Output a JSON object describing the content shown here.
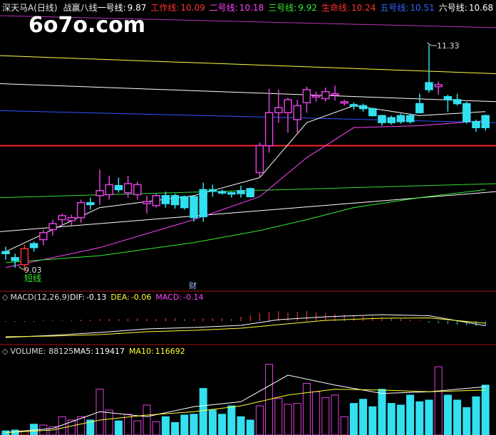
{
  "header": {
    "stock": "深天马A",
    "period": "(日线)",
    "indicator": "战赢八线",
    "lines": [
      {
        "label": "一号线:",
        "value": "9.87",
        "color": "#ffffff"
      },
      {
        "label": "工作线:",
        "value": "10.09",
        "color": "#ff3333"
      },
      {
        "label": "二号线:",
        "value": "10.18",
        "color": "#ff44ff"
      },
      {
        "label": "三号线:",
        "value": "9.92",
        "color": "#33ee33"
      },
      {
        "label": "生命线:",
        "value": "10.24",
        "color": "#ff3333"
      },
      {
        "label": "五号线:",
        "value": "10.51",
        "color": "#3366ff"
      },
      {
        "label": "六号线:",
        "value": "10.68",
        "color": "#ffffff"
      }
    ]
  },
  "watermark": "6o7o.com",
  "annotations": {
    "high": "11.33",
    "low": "9.03",
    "short_line": "短线",
    "finance_marker": "财"
  },
  "macd_panel": {
    "title": "MACD(12,26,9)",
    "items": [
      {
        "label": "DIF:",
        "value": "-0.13",
        "color": "#ffffff"
      },
      {
        "label": "DEA:",
        "value": "-0.06",
        "color": "#ffff33"
      },
      {
        "label": "MACD:",
        "value": "-0.14",
        "color": "#ff44ff"
      }
    ]
  },
  "volume_panel": {
    "title": "VOLUME:",
    "value": "88125",
    "items": [
      {
        "label": "MA5:",
        "value": "119417",
        "color": "#ffffff"
      },
      {
        "label": "MA10:",
        "value": "116692",
        "color": "#ffff33"
      }
    ]
  },
  "chart_data": {
    "type": "candlestick",
    "price_range": [
      8.9,
      11.62
    ],
    "candles": [
      {
        "o": 9.26,
        "h": 9.31,
        "l": 9.18,
        "c": 9.24,
        "color": "cyan"
      },
      {
        "o": 9.2,
        "h": 9.24,
        "l": 9.1,
        "c": 9.17,
        "color": "cyan"
      },
      {
        "o": 9.13,
        "h": 9.33,
        "l": 9.06,
        "c": 9.29,
        "color": "red"
      },
      {
        "o": 9.3,
        "h": 9.36,
        "l": 9.26,
        "c": 9.34,
        "color": "cyan"
      },
      {
        "o": 9.38,
        "h": 9.48,
        "l": 9.32,
        "c": 9.45,
        "color": "magenta"
      },
      {
        "o": 9.48,
        "h": 9.58,
        "l": 9.42,
        "c": 9.54,
        "color": "magenta"
      },
      {
        "o": 9.58,
        "h": 9.64,
        "l": 9.52,
        "c": 9.62,
        "color": "magenta"
      },
      {
        "o": 9.57,
        "h": 9.63,
        "l": 9.52,
        "c": 9.6,
        "color": "magenta"
      },
      {
        "o": 9.6,
        "h": 9.78,
        "l": 9.55,
        "c": 9.75,
        "color": "magenta"
      },
      {
        "o": 9.73,
        "h": 9.8,
        "l": 9.68,
        "c": 9.75,
        "color": "cyan"
      },
      {
        "o": 9.82,
        "h": 10.08,
        "l": 9.73,
        "c": 9.87,
        "color": "magenta"
      },
      {
        "o": 9.83,
        "h": 10.02,
        "l": 9.78,
        "c": 9.93,
        "color": "magenta"
      },
      {
        "o": 9.92,
        "h": 10.0,
        "l": 9.85,
        "c": 9.88,
        "color": "cyan"
      },
      {
        "o": 9.85,
        "h": 10.02,
        "l": 9.8,
        "c": 9.94,
        "color": "magenta"
      },
      {
        "o": 9.93,
        "h": 9.96,
        "l": 9.78,
        "c": 9.83,
        "color": "magenta"
      },
      {
        "o": 9.74,
        "h": 9.82,
        "l": 9.64,
        "c": 9.76,
        "color": "magenta"
      },
      {
        "o": 9.72,
        "h": 9.84,
        "l": 9.7,
        "c": 9.82,
        "color": "magenta"
      },
      {
        "o": 9.82,
        "h": 9.86,
        "l": 9.7,
        "c": 9.74,
        "color": "cyan"
      },
      {
        "o": 9.73,
        "h": 9.84,
        "l": 9.69,
        "c": 9.82,
        "color": "cyan"
      },
      {
        "o": 9.81,
        "h": 9.82,
        "l": 9.68,
        "c": 9.7,
        "color": "cyan"
      },
      {
        "o": 9.81,
        "h": 9.82,
        "l": 9.56,
        "c": 9.6,
        "color": "cyan"
      },
      {
        "o": 9.61,
        "h": 9.95,
        "l": 9.56,
        "c": 9.88,
        "color": "cyan"
      },
      {
        "o": 9.88,
        "h": 9.93,
        "l": 9.81,
        "c": 9.88,
        "color": "cyan"
      },
      {
        "o": 9.86,
        "h": 9.88,
        "l": 9.83,
        "c": 9.85,
        "color": "cyan"
      },
      {
        "o": 9.85,
        "h": 9.86,
        "l": 9.8,
        "c": 9.84,
        "color": "cyan"
      },
      {
        "o": 9.87,
        "h": 9.92,
        "l": 9.8,
        "c": 9.84,
        "color": "cyan"
      },
      {
        "o": 9.89,
        "h": 9.9,
        "l": 9.8,
        "c": 9.81,
        "color": "cyan"
      },
      {
        "o": 10.05,
        "h": 10.35,
        "l": 10.0,
        "c": 10.32,
        "color": "magenta"
      },
      {
        "o": 10.32,
        "h": 10.89,
        "l": 10.25,
        "c": 10.65,
        "color": "magenta"
      },
      {
        "o": 10.65,
        "h": 10.88,
        "l": 10.55,
        "c": 10.7,
        "color": "magenta"
      },
      {
        "o": 10.65,
        "h": 10.8,
        "l": 10.45,
        "c": 10.78,
        "color": "magenta"
      },
      {
        "o": 10.58,
        "h": 10.78,
        "l": 10.45,
        "c": 10.72,
        "color": "magenta"
      },
      {
        "o": 10.75,
        "h": 10.91,
        "l": 10.65,
        "c": 10.88,
        "color": "magenta"
      },
      {
        "o": 10.82,
        "h": 10.86,
        "l": 10.76,
        "c": 10.82,
        "color": "magenta"
      },
      {
        "o": 10.79,
        "h": 10.9,
        "l": 10.76,
        "c": 10.86,
        "color": "magenta"
      },
      {
        "o": 10.83,
        "h": 10.92,
        "l": 10.77,
        "c": 10.84,
        "color": "magenta"
      },
      {
        "o": 10.76,
        "h": 10.78,
        "l": 10.72,
        "c": 10.76,
        "color": "magenta"
      },
      {
        "o": 10.73,
        "h": 10.75,
        "l": 10.68,
        "c": 10.72,
        "color": "cyan"
      },
      {
        "o": 10.72,
        "h": 10.74,
        "l": 10.66,
        "c": 10.69,
        "color": "cyan"
      },
      {
        "o": 10.69,
        "h": 10.7,
        "l": 10.61,
        "c": 10.62,
        "color": "cyan"
      },
      {
        "o": 10.62,
        "h": 10.63,
        "l": 10.52,
        "c": 10.55,
        "color": "cyan"
      },
      {
        "o": 10.6,
        "h": 10.62,
        "l": 10.53,
        "c": 10.55,
        "color": "cyan"
      },
      {
        "o": 10.62,
        "h": 10.64,
        "l": 10.54,
        "c": 10.56,
        "color": "cyan"
      },
      {
        "o": 10.62,
        "h": 10.64,
        "l": 10.54,
        "c": 10.56,
        "color": "cyan"
      },
      {
        "o": 10.65,
        "h": 10.84,
        "l": 10.64,
        "c": 10.74,
        "color": "cyan"
      },
      {
        "o": 10.88,
        "h": 11.33,
        "l": 10.85,
        "c": 10.95,
        "color": "cyan"
      },
      {
        "o": 10.91,
        "h": 10.96,
        "l": 10.83,
        "c": 10.93,
        "color": "magenta"
      },
      {
        "o": 10.81,
        "h": 10.83,
        "l": 10.66,
        "c": 10.78,
        "color": "cyan"
      },
      {
        "o": 10.78,
        "h": 10.84,
        "l": 10.72,
        "c": 10.74,
        "color": "cyan"
      },
      {
        "o": 10.74,
        "h": 10.76,
        "l": 10.54,
        "c": 10.56,
        "color": "cyan"
      },
      {
        "o": 10.56,
        "h": 10.58,
        "l": 10.46,
        "c": 10.5,
        "color": "cyan"
      },
      {
        "o": 10.5,
        "h": 10.63,
        "l": 10.47,
        "c": 10.62,
        "color": "cyan"
      }
    ],
    "ma_lines": [
      {
        "name": "一号线",
        "color": "#ffffff",
        "values": [
          [
            0,
            9.26
          ],
          [
            10,
            9.7
          ],
          [
            20,
            9.82
          ],
          [
            27,
            10.0
          ],
          [
            32,
            10.55
          ],
          [
            37,
            10.72
          ],
          [
            44,
            10.62
          ],
          [
            51,
            10.66
          ]
        ]
      },
      {
        "name": "二号线",
        "color": "#ff44ff",
        "values": [
          [
            0,
            9.1
          ],
          [
            10,
            9.3
          ],
          [
            20,
            9.58
          ],
          [
            27,
            9.81
          ],
          [
            32,
            10.2
          ],
          [
            37,
            10.5
          ],
          [
            44,
            10.52
          ],
          [
            51,
            10.57
          ]
        ]
      },
      {
        "name": "三号线",
        "color": "#33ee33",
        "values": [
          [
            0,
            9.15
          ],
          [
            10,
            9.22
          ],
          [
            20,
            9.35
          ],
          [
            27,
            9.47
          ],
          [
            32,
            9.58
          ],
          [
            37,
            9.7
          ],
          [
            44,
            9.8
          ],
          [
            51,
            9.88
          ]
        ]
      }
    ],
    "h_lines": [
      {
        "color": "#ffff44",
        "y0": 11.22,
        "y1": 11.04
      },
      {
        "color": "#ffffff",
        "y0": 10.94,
        "y1": 10.76
      },
      {
        "color": "#3355ff",
        "y0": 10.67,
        "y1": 10.55
      },
      {
        "color": "#ff2222",
        "y0": 10.32,
        "y1": 10.32
      },
      {
        "color": "#33dd33",
        "y0": 9.8,
        "y1": 9.94
      },
      {
        "color": "#ffffff",
        "y0": 9.46,
        "y1": 9.86
      },
      {
        "color": "#bb33bb",
        "y0": 11.62,
        "y1": 11.5
      }
    ],
    "macd": {
      "dif": [
        [
          0,
          -0.46
        ],
        [
          5,
          -0.4
        ],
        [
          10,
          -0.32
        ],
        [
          15,
          -0.22
        ],
        [
          20,
          -0.18
        ],
        [
          25,
          -0.12
        ],
        [
          29,
          0.04
        ],
        [
          34,
          0.12
        ],
        [
          40,
          0.18
        ],
        [
          45,
          0.15
        ],
        [
          51,
          -0.13
        ]
      ],
      "dea": [
        [
          0,
          -0.44
        ],
        [
          5,
          -0.42
        ],
        [
          10,
          -0.38
        ],
        [
          15,
          -0.3
        ],
        [
          20,
          -0.26
        ],
        [
          25,
          -0.2
        ],
        [
          29,
          -0.1
        ],
        [
          34,
          0.02
        ],
        [
          40,
          0.08
        ],
        [
          45,
          0.09
        ],
        [
          51,
          -0.06
        ]
      ],
      "hist": [
        -0.02,
        -0.02,
        -0.02,
        -0.02,
        0.02,
        0.02,
        0.02,
        0.02,
        0.04,
        0.04,
        0.06,
        0.06,
        0.06,
        0.06,
        0.08,
        0.06,
        0.06,
        0.08,
        0.08,
        0.06,
        0.06,
        0.08,
        0.08,
        0.08,
        0.06,
        0.12,
        0.16,
        0.22,
        0.26,
        0.28,
        0.24,
        0.26,
        0.28,
        0.24,
        0.22,
        0.2,
        0.18,
        0.16,
        0.14,
        0.12,
        0.1,
        0.08,
        0.06,
        0.04,
        0.02,
        -0.04,
        -0.06,
        -0.08,
        -0.1,
        -0.12,
        -0.14,
        -0.14
      ],
      "range": [
        -0.58,
        0.52
      ]
    },
    "volume": {
      "bars": [
        5,
        6,
        5,
        13,
        12,
        10,
        22,
        18,
        22,
        18,
        55,
        30,
        17,
        25,
        17,
        36,
        16,
        22,
        15,
        24,
        25,
        56,
        30,
        25,
        35,
        22,
        18,
        35,
        85,
        44,
        37,
        38,
        62,
        52,
        45,
        48,
        22,
        38,
        43,
        34,
        55,
        38,
        36,
        48,
        40,
        42,
        82,
        48,
        42,
        33,
        46,
        60
      ],
      "ma5": [
        [
          0,
          3
        ],
        [
          5,
          8
        ],
        [
          10,
          28
        ],
        [
          15,
          22
        ],
        [
          20,
          34
        ],
        [
          25,
          40
        ],
        [
          30,
          72
        ],
        [
          35,
          60
        ],
        [
          40,
          50
        ],
        [
          45,
          52
        ],
        [
          51,
          58
        ]
      ],
      "ma10": [
        [
          0,
          3
        ],
        [
          5,
          6
        ],
        [
          10,
          18
        ],
        [
          15,
          24
        ],
        [
          20,
          28
        ],
        [
          25,
          35
        ],
        [
          30,
          48
        ],
        [
          35,
          55
        ],
        [
          40,
          54
        ],
        [
          45,
          52
        ],
        [
          51,
          54
        ]
      ],
      "range": [
        0,
        95
      ]
    }
  }
}
